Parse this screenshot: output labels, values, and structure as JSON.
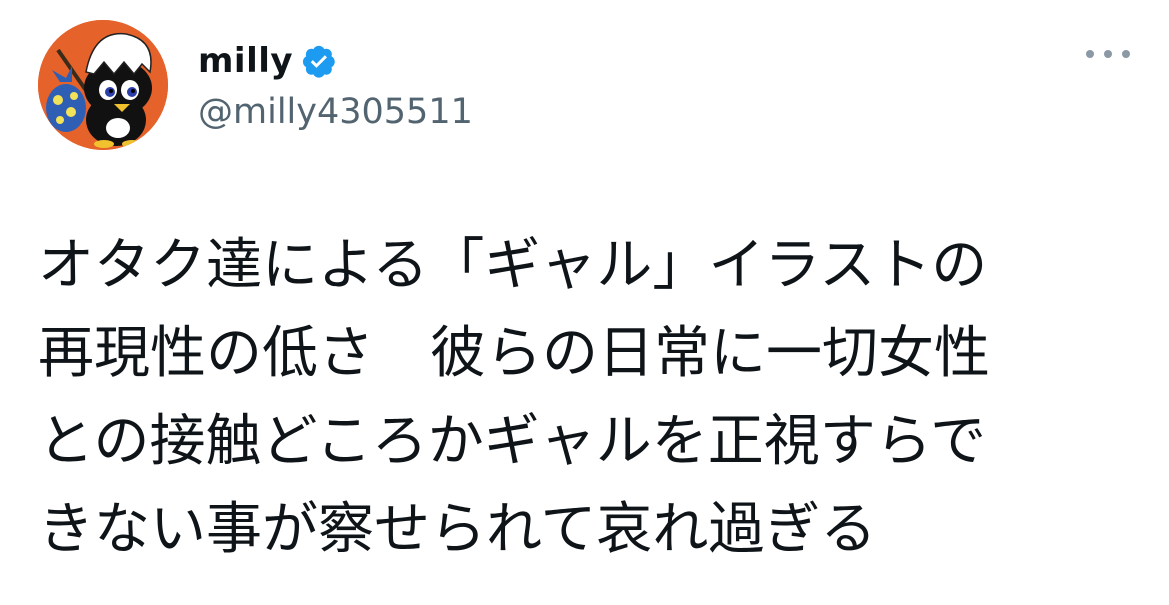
{
  "user": {
    "display_name": "milly",
    "handle": "@milly4305511",
    "verified": true,
    "avatar_icon": "calimero-chick-avatar-icon",
    "verified_icon": "verified-badge-icon"
  },
  "more_menu": {
    "icon": "more-options-icon"
  },
  "tweet": {
    "text": "オタク達による「ギャル」イラストの\n再現性の低さ　彼らの日常に一切女性\nとの接触どころかギャルを正視すらで\nきない事が察せられて哀れ過ぎる"
  },
  "colors": {
    "text_primary": "#0f1419",
    "text_secondary": "#536471",
    "verified_blue": "#1d9bf0",
    "more_dots": "#8b98a5",
    "avatar_background": "#e5622a"
  }
}
